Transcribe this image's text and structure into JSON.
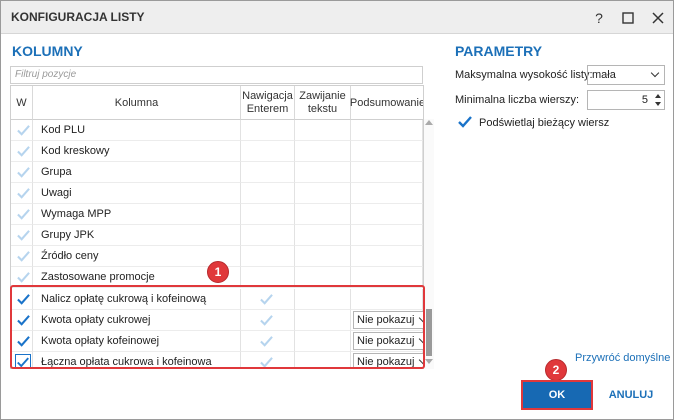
{
  "window": {
    "title": "KONFIGURACJA LISTY",
    "help": "?",
    "maximize": "☐",
    "close": "✕"
  },
  "columns": {
    "section_title": "KOLUMNY",
    "filter_placeholder": "Filtruj pozycje",
    "headers": {
      "w": "W",
      "kolumna": "Kolumna",
      "nav": "Nawigacja Enterem",
      "wrap": "Zawijanie tekstu",
      "summary": "Podsumowanie"
    },
    "rows": [
      {
        "name": "Kod PLU",
        "checked": true,
        "nav": false,
        "summary": ""
      },
      {
        "name": "Kod kreskowy",
        "checked": true,
        "nav": false,
        "summary": ""
      },
      {
        "name": "Grupa",
        "checked": true,
        "nav": false,
        "summary": ""
      },
      {
        "name": "Uwagi",
        "checked": true,
        "nav": false,
        "summary": ""
      },
      {
        "name": "Wymaga MPP",
        "checked": true,
        "nav": false,
        "summary": ""
      },
      {
        "name": "Grupy JPK",
        "checked": true,
        "nav": false,
        "summary": ""
      },
      {
        "name": "Źródło ceny",
        "checked": true,
        "nav": false,
        "summary": ""
      },
      {
        "name": "Zastosowane promocje",
        "checked": true,
        "nav": false,
        "summary": ""
      },
      {
        "name": "Nalicz opłatę cukrową i kofeinową",
        "checked": true,
        "nav": true,
        "summary": ""
      },
      {
        "name": "Kwota opłaty cukrowej",
        "checked": true,
        "nav": true,
        "summary": "Nie pokazuj"
      },
      {
        "name": "Kwota opłaty kofeinowej",
        "checked": true,
        "nav": true,
        "summary": "Nie pokazuj"
      },
      {
        "name": "Łączna opłata cukrowa i kofeinowa",
        "checked": true,
        "nav": true,
        "summary": "Nie pokazuj"
      }
    ]
  },
  "params": {
    "section_title": "PARAMETRY",
    "max_height_label": "Maksymalna wysokość listy:",
    "max_height_value": "mała",
    "min_rows_label": "Minimalna liczba wierszy:",
    "min_rows_value": "5",
    "highlight_label": "Podświetlaj bieżący wiersz"
  },
  "footer": {
    "restore_link": "Przywróć domyślne",
    "ok": "OK",
    "cancel": "ANULUJ"
  },
  "callouts": {
    "one": "1",
    "two": "2"
  },
  "colors": {
    "accent": "#1c70b8",
    "check_active": "#1a73c9",
    "check_faded": "#b6d4ee",
    "callout": "#e0383b"
  }
}
